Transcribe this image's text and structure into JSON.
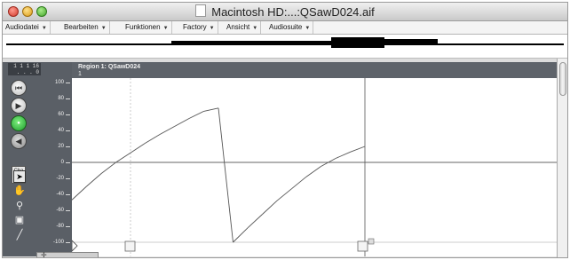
{
  "window": {
    "title": "Macintosh HD:...:QSawD024.aif"
  },
  "menus": [
    {
      "label": "Audiodatei"
    },
    {
      "label": "Bearbeiten"
    },
    {
      "label": "Funktionen"
    },
    {
      "label": "Factory"
    },
    {
      "label": "Ansicht"
    },
    {
      "label": "Audiosuite"
    }
  ],
  "position_display": {
    "line1": "1 1 1 16",
    "line2": ". . . 0"
  },
  "region": {
    "name": "Region 1: QSawD024",
    "number": "1"
  },
  "toolbar": {
    "channel_label": "Cha",
    "channel_value": "1"
  },
  "y_axis": {
    "ticks": [
      "100",
      "80",
      "60",
      "40",
      "20",
      "0",
      "-20",
      "-40",
      "-60",
      "-80",
      "-100"
    ]
  },
  "colors": {
    "editor_bg": "#5a5f66",
    "plot_bg": "#ffffff",
    "waveform": "#555555",
    "record_button": "#22aa33"
  },
  "icons": {
    "tools": [
      "pointer-icon",
      "hand-icon",
      "magnifier-icon",
      "eraser-icon",
      "pencil-icon"
    ],
    "buttons": [
      "go-to-start-icon",
      "play-icon",
      "record-icon",
      "speaker-icon"
    ]
  },
  "chart_data": {
    "type": "line",
    "x": [
      0,
      0.05,
      0.1,
      0.15,
      0.2,
      0.25,
      0.3,
      0.35,
      0.4,
      0.45,
      0.5,
      0.55,
      0.6,
      0.65,
      0.7,
      0.75,
      0.8,
      0.85,
      0.9,
      0.95,
      1.0
    ],
    "y": [
      -47,
      -30,
      -14,
      0,
      12,
      24,
      35,
      45,
      55,
      64,
      68,
      -100,
      -82,
      -65,
      -48,
      -33,
      -18,
      -5,
      5,
      13,
      20
    ],
    "ylim": [
      -100,
      100
    ],
    "xlim": [
      0,
      1.0
    ],
    "grid": true,
    "title": "",
    "xlabel": "",
    "ylabel": ""
  }
}
